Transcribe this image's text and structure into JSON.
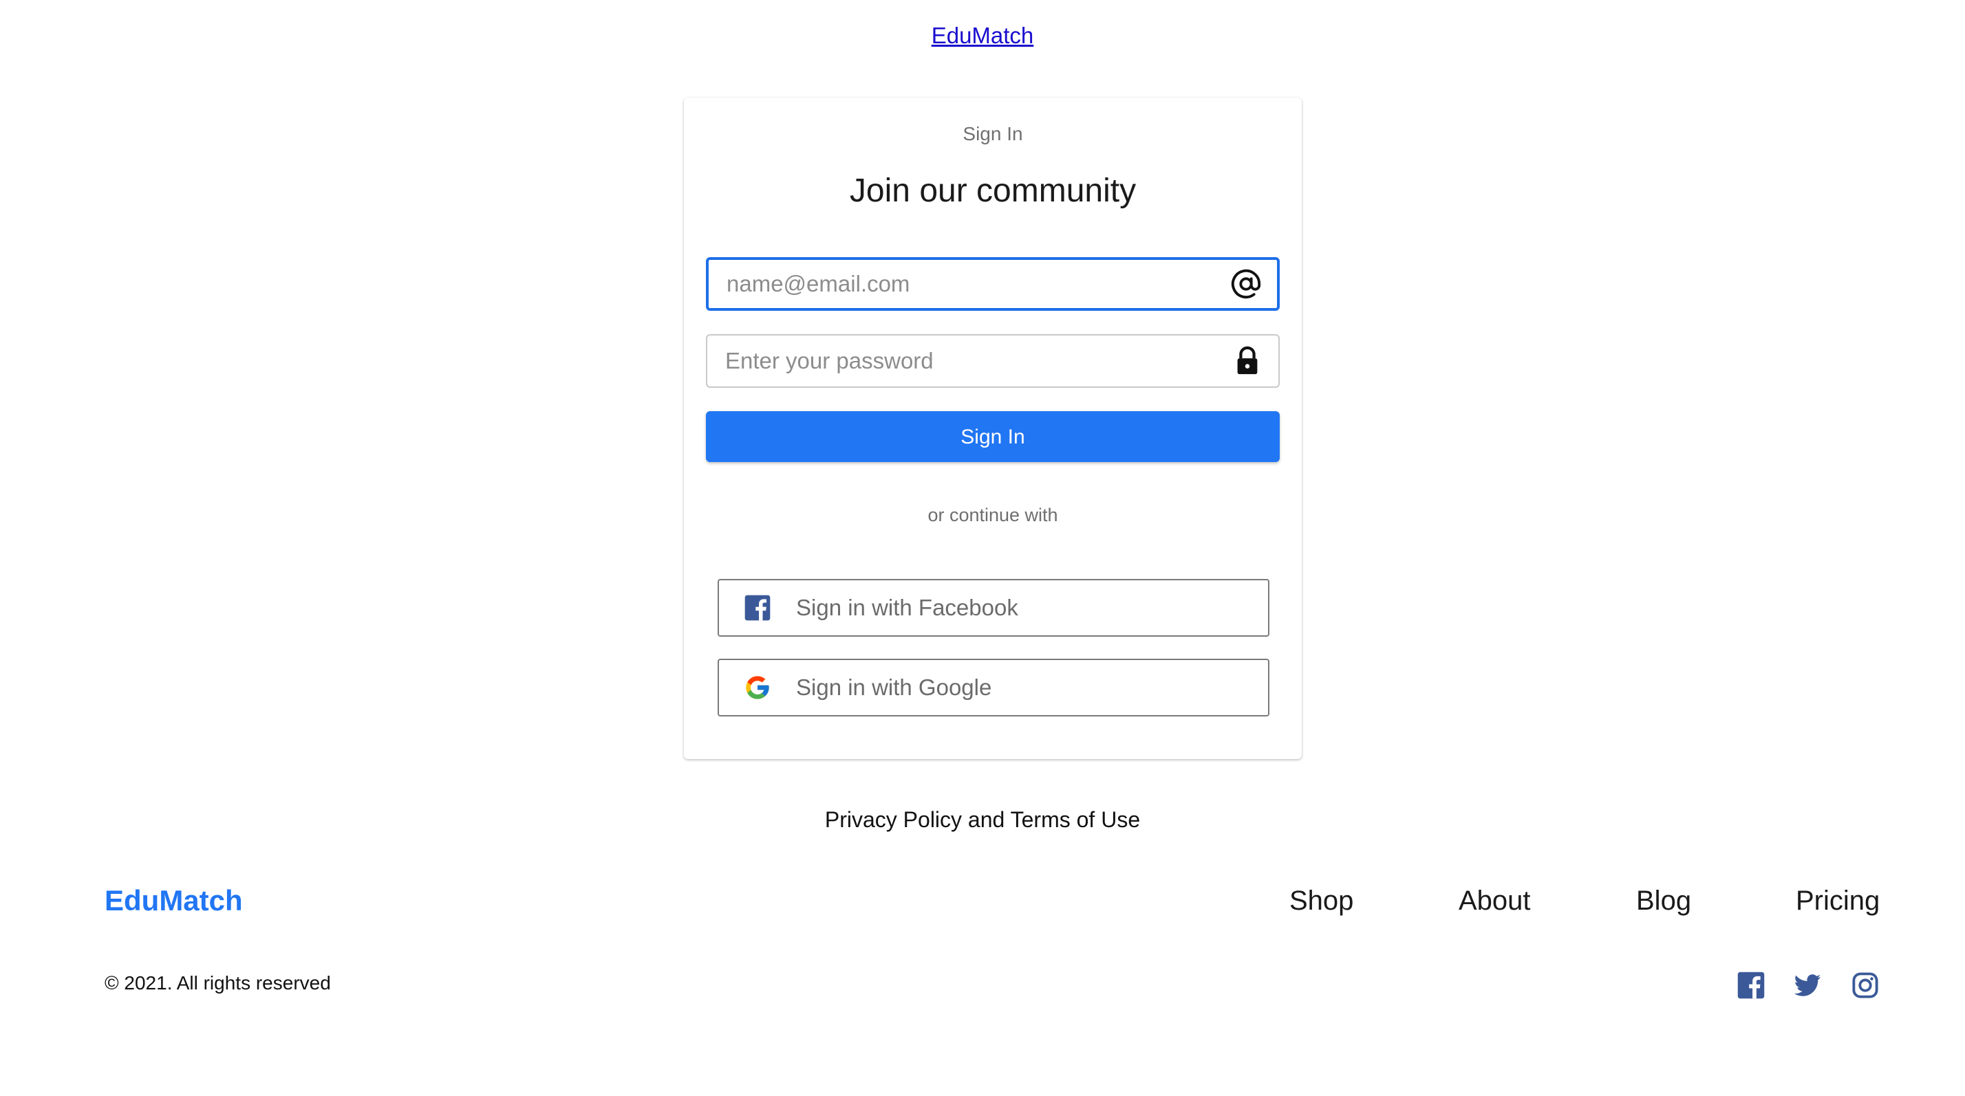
{
  "header": {
    "brand_link": "EduMatch"
  },
  "card": {
    "eyebrow": "Sign In",
    "title": "Join our community",
    "email": {
      "placeholder": "name@email.com",
      "value": "",
      "icon": "at-sign-icon"
    },
    "password": {
      "placeholder": "Enter your password",
      "value": "",
      "icon": "lock-icon"
    },
    "submit_label": "Sign In",
    "divider": "or continue with",
    "social": [
      {
        "label": "Sign in with Facebook",
        "icon": "facebook-icon"
      },
      {
        "label": "Sign in with Google",
        "icon": "google-icon"
      }
    ]
  },
  "policy_link": "Privacy Policy and Terms of Use",
  "footer": {
    "brand": "EduMatch",
    "nav": [
      "Shop",
      "About",
      "Blog",
      "Pricing"
    ],
    "copyright": "© 2021. All rights reserved",
    "social_icons": [
      "facebook-icon",
      "twitter-icon",
      "instagram-icon"
    ]
  },
  "colors": {
    "primary": "#2176f3",
    "focus_border": "#1e6fe8",
    "social_icon": "#3b5998",
    "link": "#1a0dce"
  }
}
